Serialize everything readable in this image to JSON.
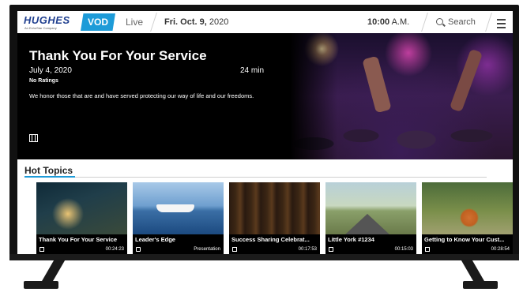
{
  "header": {
    "brand": "HUGHES",
    "brand_sub": "An EchoStar Company",
    "tabs": [
      {
        "label": "VOD",
        "active": true
      },
      {
        "label": "Live",
        "active": false
      }
    ],
    "date_day": "Fri. Oct. 9,",
    "date_year": "2020",
    "time": "10:00",
    "time_suffix": "A.M.",
    "search_label": "Search",
    "accent_color": "#1d9bd8"
  },
  "hero": {
    "title": "Thank You For Your Service",
    "date": "July 4, 2020",
    "duration": "24 min",
    "rating": "No Ratings",
    "description": "We honor those that are and have served protecting our way of life and our freedoms.",
    "type_icon": "film-icon"
  },
  "hot_topics": {
    "title": "Hot Topics",
    "items": [
      {
        "title": "Thank You For Your Service",
        "meta": "00:24:23",
        "icon": "film-icon"
      },
      {
        "title": "Leader's Edge",
        "meta": "Presentation",
        "icon": "presentation-icon"
      },
      {
        "title": "Success Sharing Celebrat...",
        "meta": "00:17:53",
        "icon": "film-icon"
      },
      {
        "title": "Little York #1234",
        "meta": "00:15:03",
        "icon": "film-icon"
      },
      {
        "title": "Getting to Know Your Cust...",
        "meta": "00:28:54",
        "icon": "film-icon"
      }
    ]
  }
}
